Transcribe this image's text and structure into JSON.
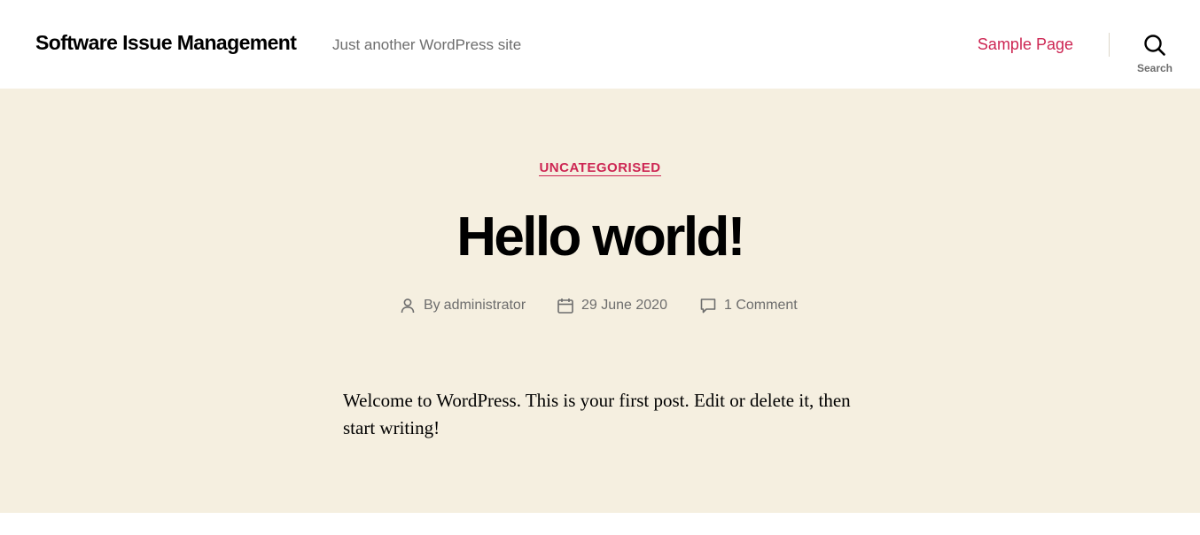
{
  "header": {
    "site_title": "Software Issue Management",
    "site_description": "Just another WordPress site",
    "nav": [
      {
        "label": "Sample Page"
      }
    ],
    "search_label": "Search"
  },
  "post": {
    "category": "UNCATEGORISED",
    "title": "Hello world!",
    "meta": {
      "author_prefix": "By ",
      "author": "administrator",
      "date": "29 June 2020",
      "comments": "1 Comment"
    },
    "content": "Welcome to WordPress. This is your first post. Edit or delete it, then start writing!"
  },
  "colors": {
    "accent": "#cd2653",
    "background": "#f5efe0",
    "secondary_text": "#6d6d6d"
  },
  "icons": {
    "search": "search-icon",
    "author": "user-icon",
    "date": "calendar-icon",
    "comments": "comment-icon"
  }
}
